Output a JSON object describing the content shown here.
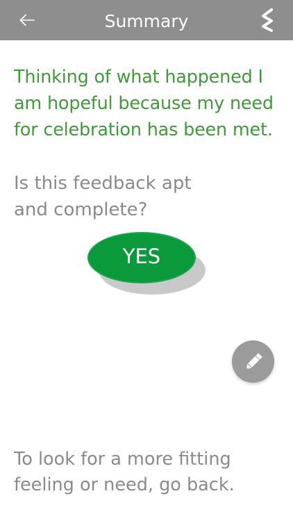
{
  "header": {
    "title": "Summary",
    "back_icon": "arrow-left-icon",
    "menu_icon": "zigzag-menu-icon",
    "background_color": "#8e8e8e"
  },
  "main": {
    "summary_text": "Thinking of what happened I am hopeful because my need for celebration has been met.",
    "summary_color": "#3f9b37",
    "question": "Is this feedback apt and complete?",
    "yes_label": "YES",
    "yes_color": "#0a9a3c",
    "edit_icon": "pencil-icon",
    "go_back_note": "To look for a more fitting feeling or need, go back."
  }
}
